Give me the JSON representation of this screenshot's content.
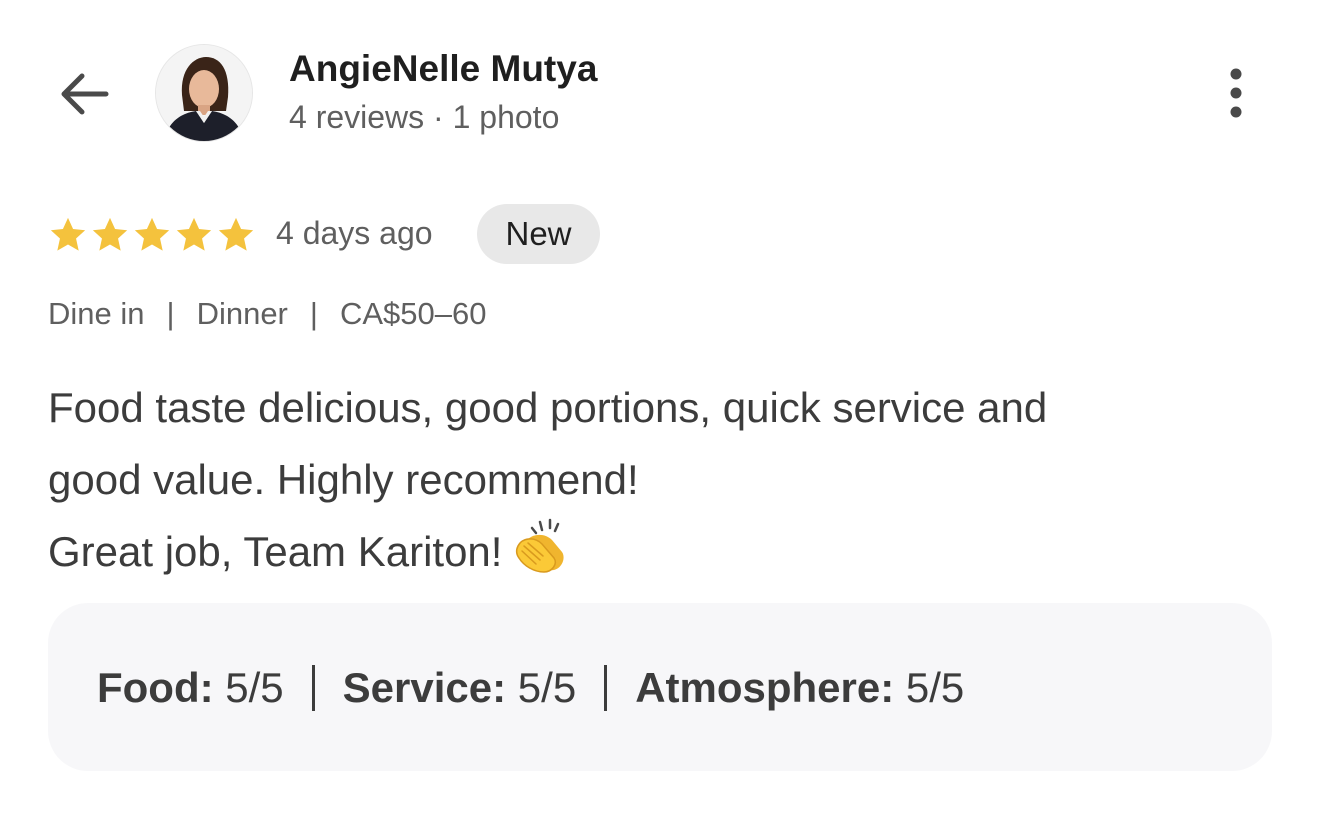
{
  "header": {
    "back_icon": "arrow-left-icon",
    "user_name": "AngieNelle Mutya",
    "user_meta": "4 reviews · 1 photo",
    "more_icon": "more-vertical-icon"
  },
  "review": {
    "rating": 5,
    "max_rating": 5,
    "star_color": "#f4c23d",
    "time_ago": "4 days ago",
    "badge": "New",
    "tags": [
      "Dine in",
      "Dinner",
      "CA$50–60"
    ],
    "tag_separator": "|",
    "text_lines": [
      "Food taste delicious, good portions, quick service and",
      "good value. Highly recommend!",
      "Great job, Team Kariton!"
    ],
    "emoji_icon": "clapping-hands-icon"
  },
  "ratings": [
    {
      "label": "Food:",
      "value": "5/5"
    },
    {
      "label": "Service:",
      "value": "5/5"
    },
    {
      "label": "Atmosphere:",
      "value": "5/5"
    }
  ]
}
